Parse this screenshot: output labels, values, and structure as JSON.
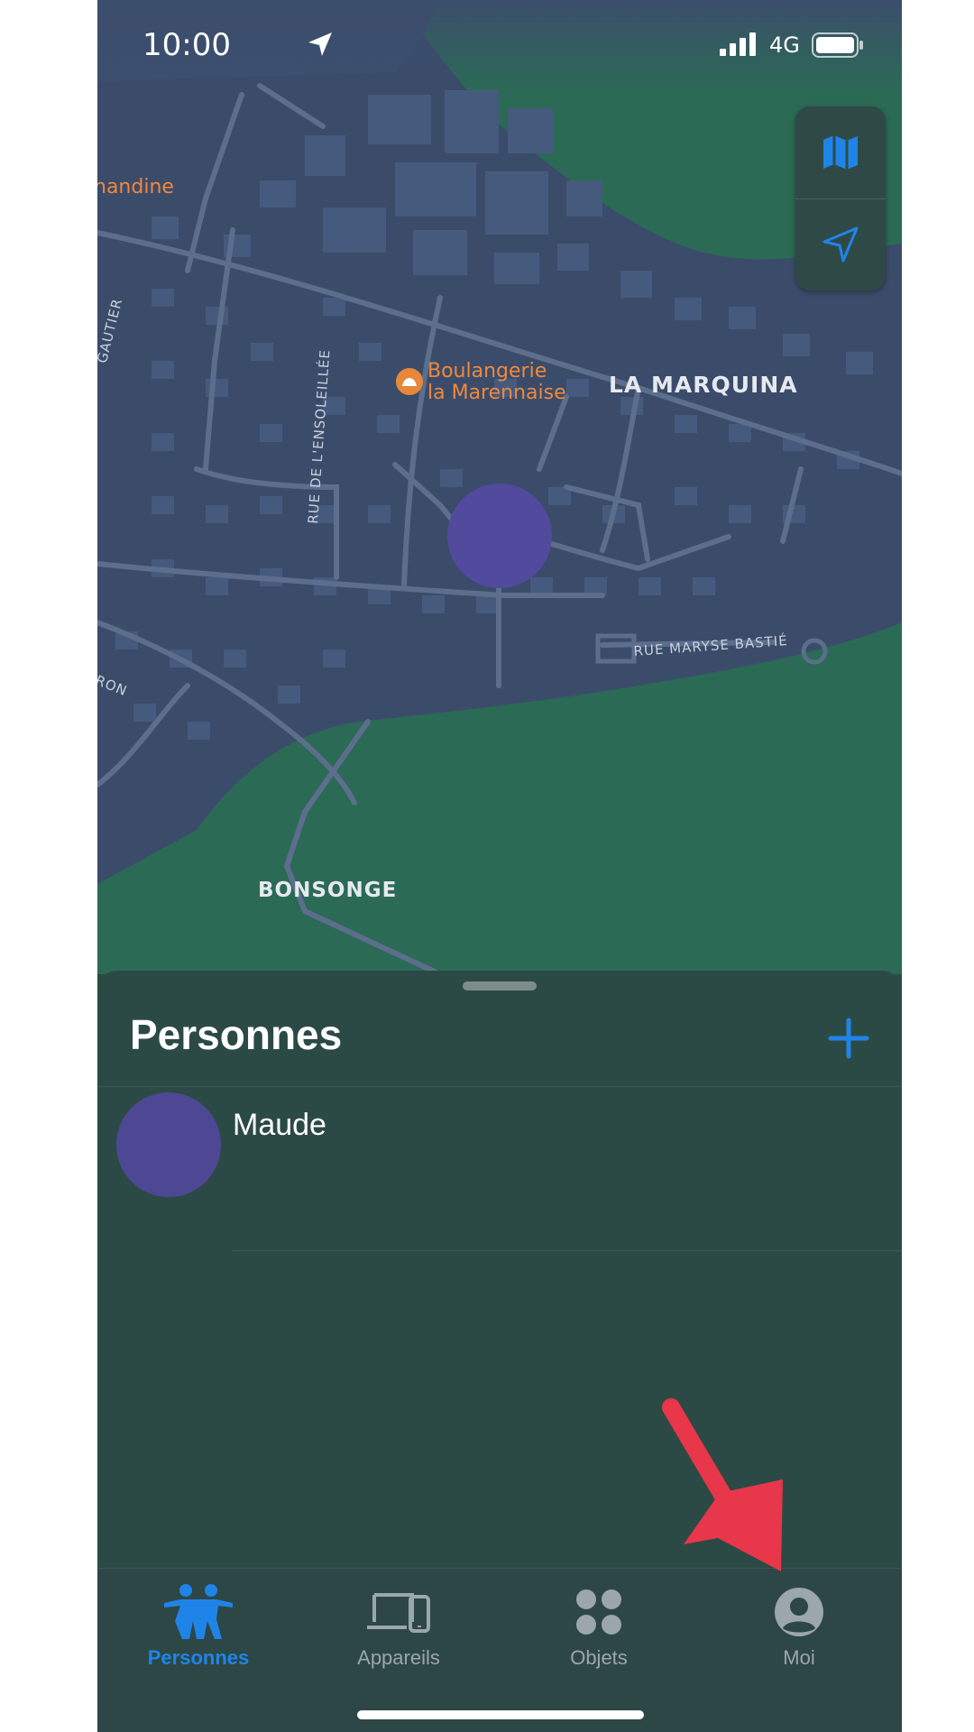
{
  "status_bar": {
    "time": "10:00",
    "network": "4G"
  },
  "map": {
    "areas": [
      "LA MARQUINA",
      "BONSONGE"
    ],
    "poi": {
      "line1": "Boulangerie",
      "line2": "la Marennaise"
    },
    "partial_poi": "nandine",
    "streets": [
      "RUE DE L'ENSOLEILLÉE",
      "RUE MARYSE BASTIÉ",
      "GAUTIER",
      "RON"
    ],
    "controls": {
      "map_icon": "map-icon",
      "location_icon": "location-arrow-icon"
    }
  },
  "sheet": {
    "title": "Personnes",
    "add_icon": "plus-icon",
    "people": [
      {
        "name": "Maude"
      }
    ]
  },
  "tabs": [
    {
      "label": "Personnes",
      "icon": "people-icon",
      "active": true
    },
    {
      "label": "Appareils",
      "icon": "devices-icon",
      "active": false
    },
    {
      "label": "Objets",
      "icon": "items-icon",
      "active": false
    },
    {
      "label": "Moi",
      "icon": "person-circle-icon",
      "active": false
    }
  ],
  "colors": {
    "accent": "#1f84e8",
    "map_land": "#3b4c6b",
    "water_green": "#2b6a55",
    "sheet_bg": "#2c4a45",
    "location_dot": "#514a9d",
    "arrow": "#e8364a"
  }
}
